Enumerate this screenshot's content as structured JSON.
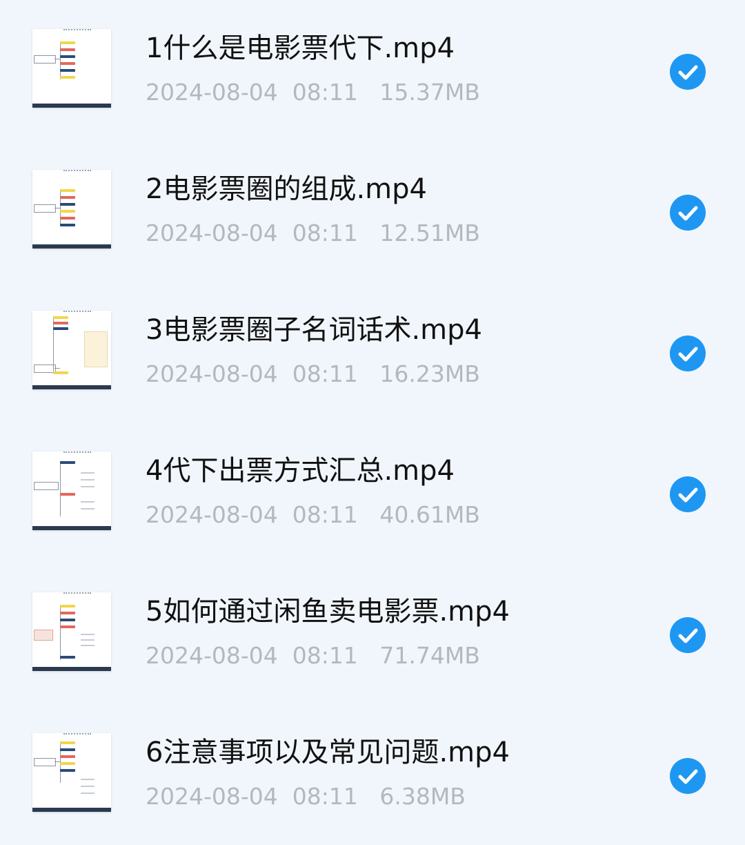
{
  "colors": {
    "background": "#f1f6fc",
    "title": "#111111",
    "meta": "#b4b8bd",
    "check_accent": "#1e97f2"
  },
  "files": [
    {
      "name": "1什么是电影票代下.mp4",
      "date": "2024-08-04",
      "time": "08:11",
      "size": "15.37MB",
      "selected": true,
      "thumbnail_icon": "mind-map-thumbnail"
    },
    {
      "name": "2电影票圈的组成.mp4",
      "date": "2024-08-04",
      "time": "08:11",
      "size": "12.51MB",
      "selected": true,
      "thumbnail_icon": "mind-map-thumbnail"
    },
    {
      "name": "3电影票圈子名词话术.mp4",
      "date": "2024-08-04",
      "time": "08:11",
      "size": "16.23MB",
      "selected": true,
      "thumbnail_icon": "mind-map-thumbnail"
    },
    {
      "name": "4代下出票方式汇总.mp4",
      "date": "2024-08-04",
      "time": "08:11",
      "size": "40.61MB",
      "selected": true,
      "thumbnail_icon": "mind-map-thumbnail"
    },
    {
      "name": "5如何通过闲鱼卖电影票.mp4",
      "date": "2024-08-04",
      "time": "08:11",
      "size": "71.74MB",
      "selected": true,
      "thumbnail_icon": "mind-map-thumbnail"
    },
    {
      "name": "6注意事项以及常见问题.mp4",
      "date": "2024-08-04",
      "time": "08:11",
      "size": "6.38MB",
      "selected": true,
      "thumbnail_icon": "mind-map-thumbnail"
    }
  ]
}
